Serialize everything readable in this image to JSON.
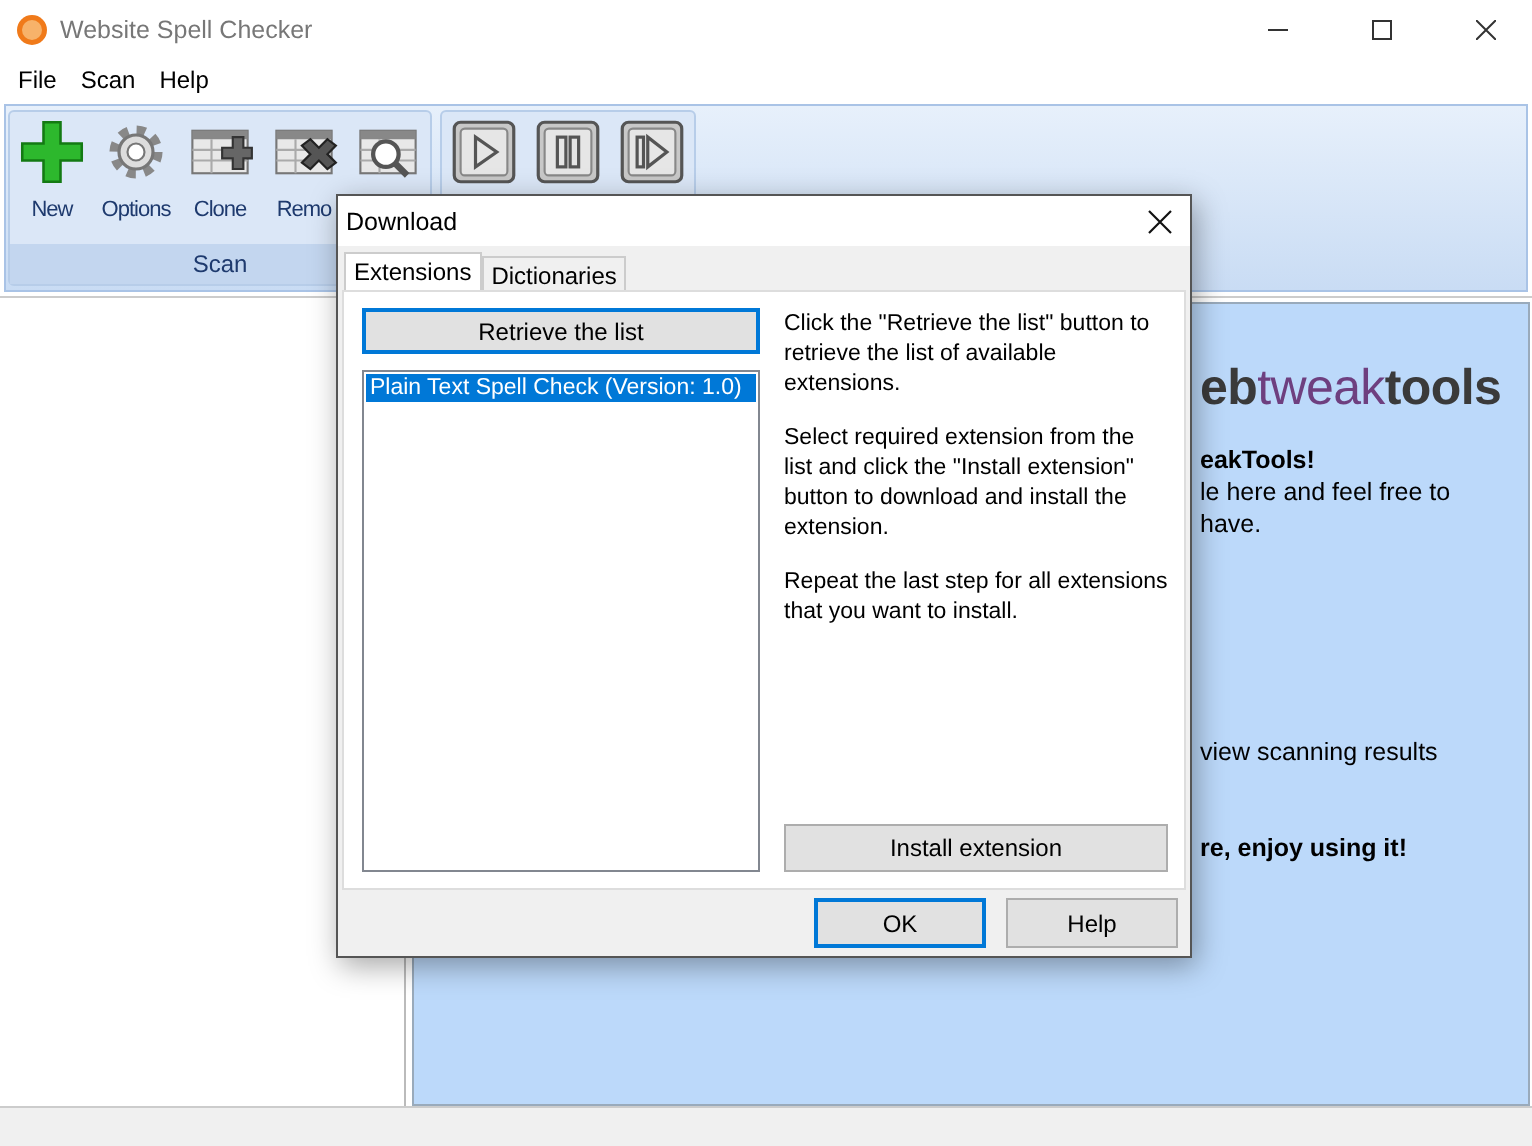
{
  "window": {
    "title": "Website Spell Checker"
  },
  "menu": [
    "File",
    "Scan",
    "Help"
  ],
  "toolbar": {
    "groups": [
      {
        "label": "Scan",
        "buttons": [
          {
            "label": "New",
            "kind": "new"
          },
          {
            "label": "Options",
            "kind": "options"
          },
          {
            "label": "Clone",
            "kind": "clone"
          },
          {
            "label": "Remo",
            "kind": "remove"
          },
          {
            "kind": "view"
          }
        ]
      },
      {
        "buttons": [
          {
            "kind": "start"
          },
          {
            "kind": "pause"
          },
          {
            "kind": "restart"
          }
        ]
      }
    ]
  },
  "welcome": {
    "logo": [
      {
        "text": "eb",
        "kind": "dark"
      },
      {
        "text": "tweak",
        "kind": "accent"
      },
      {
        "text": "tools",
        "kind": "dark"
      }
    ],
    "paragraphs": [
      [
        {
          "text": "eakTools!",
          "bold": true
        },
        {
          "text": "le here and feel free to",
          "bold": false
        },
        {
          "text": "have.",
          "bold": false
        }
      ],
      [
        {
          "text": "view scanning results",
          "bold": false
        }
      ],
      [
        {
          "text": "re, enjoy using it!",
          "bold": true
        }
      ]
    ]
  },
  "dialog": {
    "title": "Download",
    "tabs": [
      {
        "label": "Extensions",
        "selected": true
      },
      {
        "label": "Dictionaries",
        "selected": false
      }
    ],
    "retrieve_button": "Retrieve the list",
    "extensions": [
      {
        "label": "Plain Text Spell Check (Version: 1.0)",
        "selected": true
      }
    ],
    "instructions": [
      "Click the \"Retrieve the list\" button to retrieve the list of available extensions.",
      "Select required extension from the list and click the \"Install extension\" button to download and install the extension.",
      "Repeat the last step for all extensions that you want to install."
    ],
    "install_button": "Install extension",
    "buttons": [
      {
        "label": "OK",
        "default": true
      },
      {
        "label": "Help",
        "default": false
      }
    ]
  }
}
